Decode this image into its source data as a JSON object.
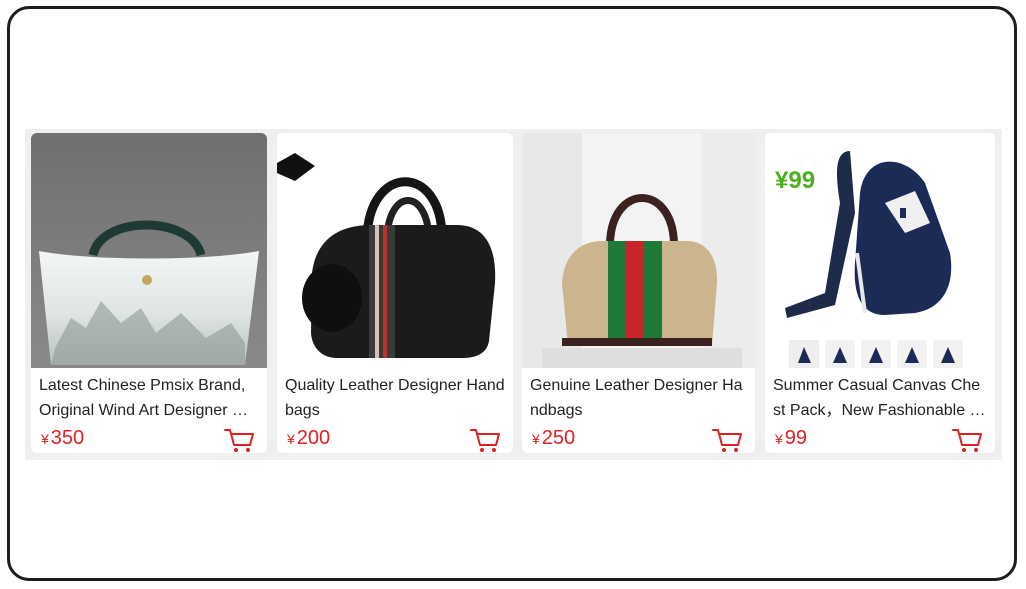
{
  "products": [
    {
      "title": "Latest Chinese Pmsix Brand, Original Wind Art Designer Handbags",
      "currency": "¥",
      "price": "350"
    },
    {
      "title": "Quality Leather Designer Handbags",
      "currency": "¥",
      "price": "200"
    },
    {
      "title": "Genuine Leather Designer Handbags",
      "currency": "¥",
      "price": "250"
    },
    {
      "title": "Summer Casual Canvas Chest Pack，New Fashionable Shoulder Bag",
      "currency": "¥",
      "price": "99",
      "image_overlay_price": "¥99"
    }
  ],
  "colors": {
    "price": "#e02020",
    "overlay_price": "#4caf1e",
    "card_bg": "#ffffff",
    "strip_bg": "#efefef"
  },
  "icons": [
    "cart-icon"
  ]
}
